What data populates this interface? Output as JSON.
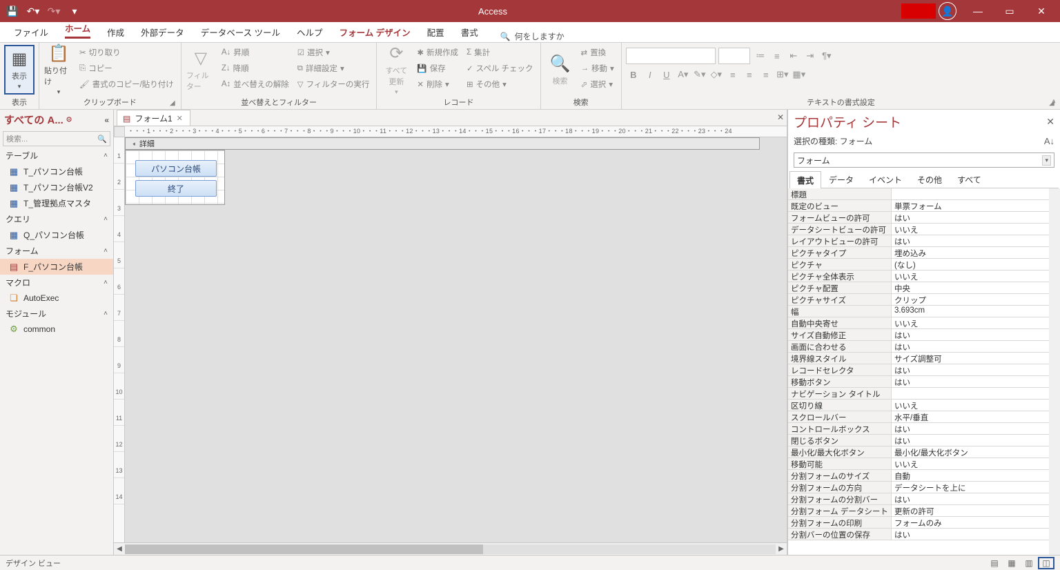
{
  "titlebar": {
    "app_title": "Access"
  },
  "tabs": {
    "file": "ファイル",
    "home": "ホーム",
    "create": "作成",
    "external": "外部データ",
    "dbtools": "データベース ツール",
    "help": "ヘルプ",
    "formdesign": "フォーム デザイン",
    "arrange": "配置",
    "format": "書式",
    "tellme": "何をしますか"
  },
  "ribbon": {
    "view": "表示",
    "view_group": "表示",
    "paste": "貼り付け",
    "cut": "切り取り",
    "copy": "コピー",
    "fmtpainter": "書式のコピー/貼り付け",
    "clipboard_group": "クリップボード",
    "filter": "フィルター",
    "asc": "昇順",
    "desc": "降順",
    "clearsort": "並べ替えの解除",
    "selection": "選択",
    "advanced": "詳細設定",
    "togglefilter": "フィルターの実行",
    "sort_group": "並べ替えとフィルター",
    "refresh": "すべて\n更新",
    "new": "新規作成",
    "save": "保存",
    "delete": "削除",
    "totals": "集計",
    "spell": "スペル チェック",
    "more": "その他",
    "records_group": "レコード",
    "find": "検索",
    "replace": "置換",
    "goto": "移動",
    "select": "選択",
    "find_group": "検索",
    "textfmt_group": "テキストの書式設定"
  },
  "nav": {
    "header": "すべての A...",
    "search_placeholder": "検索...",
    "cat_tables": "テーブル",
    "t1": "T_パソコン台帳",
    "t2": "T_パソコン台帳V2",
    "t3": "T_管理拠点マスタ",
    "cat_queries": "クエリ",
    "q1": "Q_パソコン台帳",
    "cat_forms": "フォーム",
    "f1": "F_パソコン台帳",
    "cat_macros": "マクロ",
    "m1": "AutoExec",
    "cat_modules": "モジュール",
    "mod1": "common"
  },
  "doctab": {
    "name": "フォーム1"
  },
  "hruler_text": "・・・1・・・2・・・3・・・4・・・5・・・6・・・7・・・8・・・9・・・10・・・11・・・12・・・13・・・14・・・15・・・16・・・17・・・18・・・19・・・20・・・21・・・22・・・23・・・24",
  "section_detail": "詳細",
  "form_buttons": {
    "btn1": "パソコン台帳",
    "btn2": "終了"
  },
  "propsheet": {
    "title": "プロパティ シート",
    "seltype": "選択の種類: フォーム",
    "combo": "フォーム",
    "tab_format": "書式",
    "tab_data": "データ",
    "tab_event": "イベント",
    "tab_other": "その他",
    "tab_all": "すべて",
    "props": [
      [
        "標題",
        ""
      ],
      [
        "既定のビュー",
        "単票フォーム"
      ],
      [
        "フォームビューの許可",
        "はい"
      ],
      [
        "データシートビューの許可",
        "いいえ"
      ],
      [
        "レイアウトビューの許可",
        "はい"
      ],
      [
        "ピクチャタイプ",
        "埋め込み"
      ],
      [
        "ピクチャ",
        "(なし)"
      ],
      [
        "ピクチャ全体表示",
        "いいえ"
      ],
      [
        "ピクチャ配置",
        "中央"
      ],
      [
        "ピクチャサイズ",
        "クリップ"
      ],
      [
        "幅",
        "3.693cm"
      ],
      [
        "自動中央寄せ",
        "いいえ"
      ],
      [
        "サイズ自動修正",
        "はい"
      ],
      [
        "画面に合わせる",
        "はい"
      ],
      [
        "境界線スタイル",
        "サイズ調整可"
      ],
      [
        "レコードセレクタ",
        "はい"
      ],
      [
        "移動ボタン",
        "はい"
      ],
      [
        "ナビゲーション タイトル",
        ""
      ],
      [
        "区切り線",
        "いいえ"
      ],
      [
        "スクロールバー",
        "水平/垂直"
      ],
      [
        "コントロールボックス",
        "はい"
      ],
      [
        "閉じるボタン",
        "はい"
      ],
      [
        "最小化/最大化ボタン",
        "最小化/最大化ボタン"
      ],
      [
        "移動可能",
        "いいえ"
      ],
      [
        "分割フォームのサイズ",
        "自動"
      ],
      [
        "分割フォームの方向",
        "データシートを上に"
      ],
      [
        "分割フォームの分割バー",
        "はい"
      ],
      [
        "分割フォーム データシート",
        "更新の許可"
      ],
      [
        "分割フォームの印刷",
        "フォームのみ"
      ],
      [
        "分割バーの位置の保存",
        "はい"
      ]
    ]
  },
  "statusbar": {
    "text": "デザイン ビュー"
  }
}
